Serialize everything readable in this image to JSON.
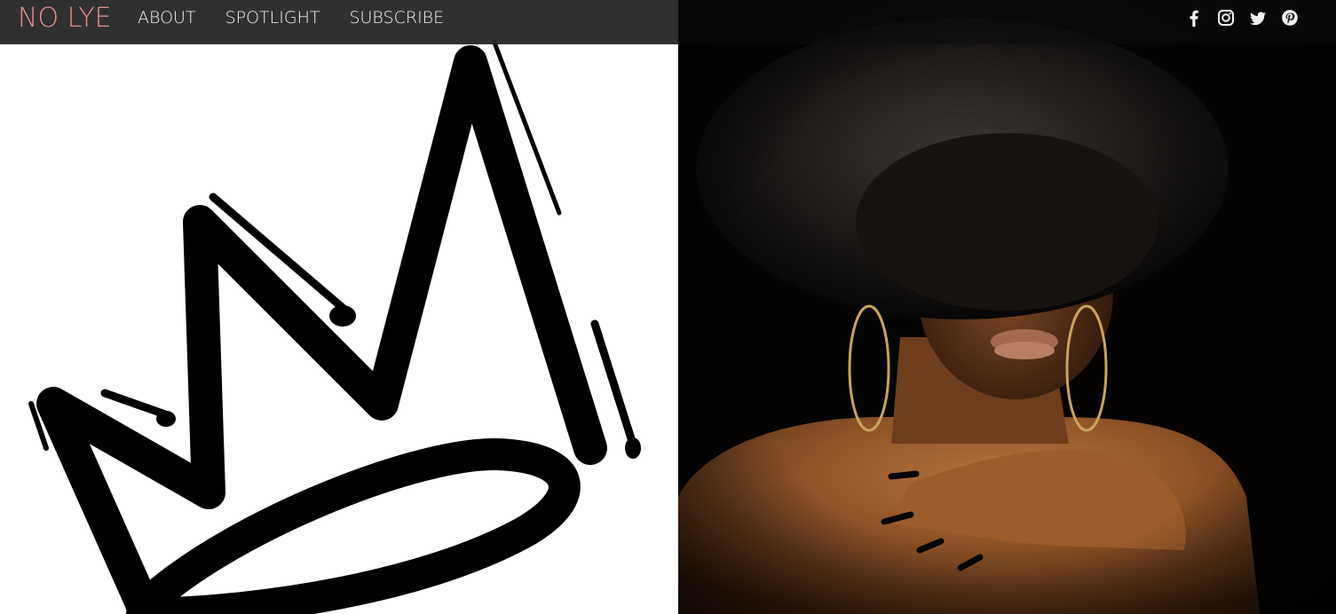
{
  "brand": {
    "name": "NO LYE",
    "color": "#e58e8e"
  },
  "nav": {
    "items": [
      {
        "label": "ABOUT"
      },
      {
        "label": "SPOTLIGHT"
      },
      {
        "label": "SUBSCRIBE"
      }
    ]
  },
  "social": {
    "icons": [
      "facebook-icon",
      "instagram-icon",
      "twitter-icon",
      "pinterest-icon"
    ]
  },
  "hero": {
    "left_image": "crown-logo",
    "right_image": "afro-portrait"
  }
}
